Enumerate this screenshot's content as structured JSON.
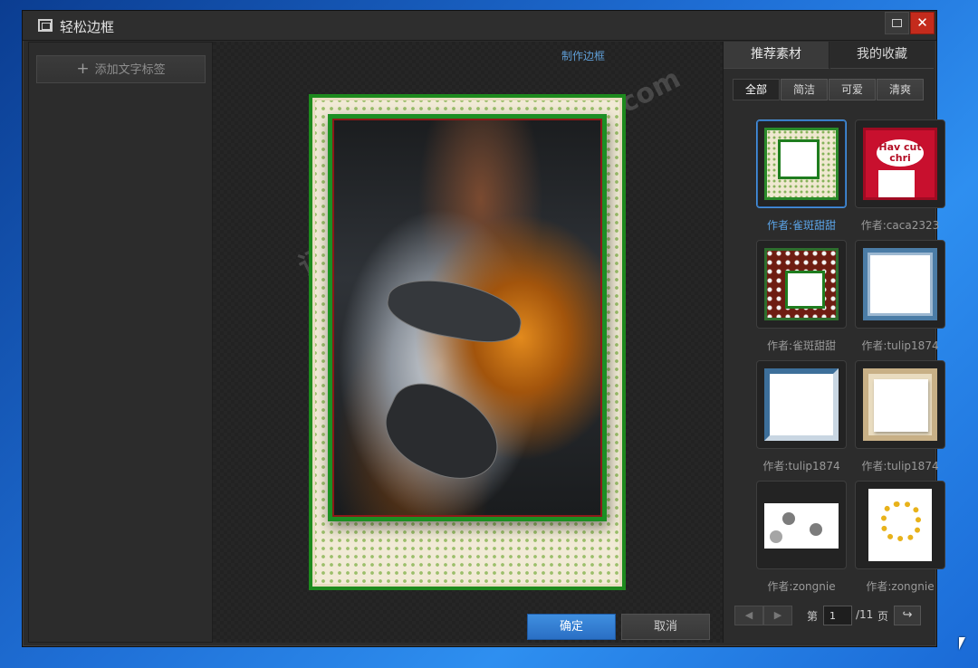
{
  "window": {
    "title": "轻松边框",
    "close_glyph": "✕"
  },
  "left_panel": {
    "add_text_tag_label": "添加文字标签",
    "plus_glyph": "+"
  },
  "canvas": {
    "title": "制作边框",
    "watermark": "记得收藏:黑域基地 Hybase.com"
  },
  "actions": {
    "ok_label": "确定",
    "cancel_label": "取消"
  },
  "right_panel": {
    "tabs": [
      {
        "label": "推荐素材",
        "active": true
      },
      {
        "label": "我的收藏",
        "active": false
      }
    ],
    "filters": [
      {
        "label": "全部",
        "active": true
      },
      {
        "label": "简洁",
        "active": false
      },
      {
        "label": "可爱",
        "active": false
      },
      {
        "label": "清爽",
        "active": false
      }
    ],
    "items": [
      {
        "caption": "作者:雀斑甜甜",
        "style": "green",
        "selected": true
      },
      {
        "caption": "作者:caca2323",
        "style": "red",
        "selected": false,
        "thumb_text": "Hav cut chri"
      },
      {
        "caption": "作者:雀斑甜甜",
        "style": "xmas",
        "selected": false
      },
      {
        "caption": "作者:tulip1874",
        "style": "blue",
        "selected": false
      },
      {
        "caption": "作者:tulip1874",
        "style": "blue2",
        "selected": false
      },
      {
        "caption": "作者:tulip1874",
        "style": "tan",
        "selected": false
      },
      {
        "caption": "作者:zongnie",
        "style": "flower",
        "selected": false
      },
      {
        "caption": "作者:zongnie",
        "style": "yellow",
        "selected": false
      }
    ],
    "pager": {
      "prev_glyph": "◀",
      "next_glyph": "▶",
      "page_prefix": "第",
      "current_page": "1",
      "total_pages": "/11",
      "page_suffix": "页",
      "go_glyph": "↪"
    }
  },
  "colors": {
    "accent_blue": "#4a90d9",
    "close_red": "#c42b1c",
    "frame_green": "#1d8a1d"
  }
}
